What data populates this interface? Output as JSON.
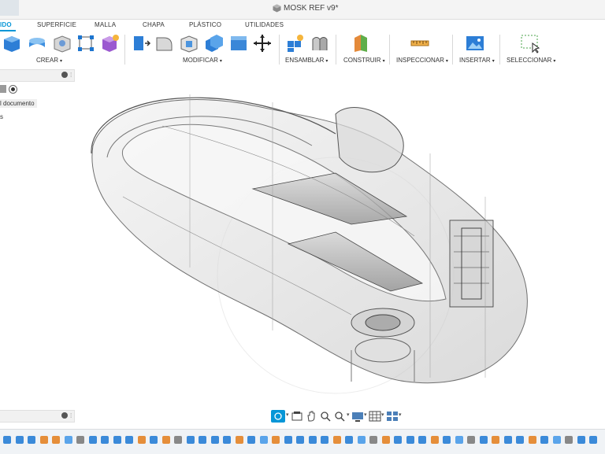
{
  "window": {
    "title": "MOSK REF v9*",
    "doc_icon": "cube-icon"
  },
  "tabs": [
    {
      "label": "IDO",
      "active": true
    },
    {
      "label": "SUPERFICIE",
      "active": false
    },
    {
      "label": "MALLA",
      "active": false
    },
    {
      "label": "CHAPA",
      "active": false
    },
    {
      "label": "PLÁSTICO",
      "active": false
    },
    {
      "label": "UTILIDADES",
      "active": false
    }
  ],
  "toolbar_groups": [
    {
      "label": "CREAR",
      "icons": [
        "extrude-box-icon",
        "revolve-icon",
        "hole-icon",
        "sketch-pattern-icon",
        "form-icon"
      ]
    },
    {
      "label": "MODIFICAR",
      "icons": [
        "press-pull-icon",
        "fillet-icon",
        "shell-icon",
        "combine-icon",
        "move-icon"
      ]
    },
    {
      "label": "ENSAMBLAR",
      "icons": [
        "new-component-icon",
        "joint-icon"
      ]
    },
    {
      "label": "CONSTRUIR",
      "icons": [
        "offset-plane-icon"
      ]
    },
    {
      "label": "INSPECCIONAR",
      "icons": [
        "measure-icon"
      ]
    },
    {
      "label": "INSERTAR",
      "icons": [
        "insert-image-icon"
      ]
    },
    {
      "label": "SELECCIONAR",
      "icons": [
        "select-window-icon"
      ]
    }
  ],
  "browser": {
    "node_1": "l documento",
    "node_2": "s"
  },
  "colors": {
    "accent": "#0696d7",
    "timeline_bg": "#f0f3f6"
  }
}
